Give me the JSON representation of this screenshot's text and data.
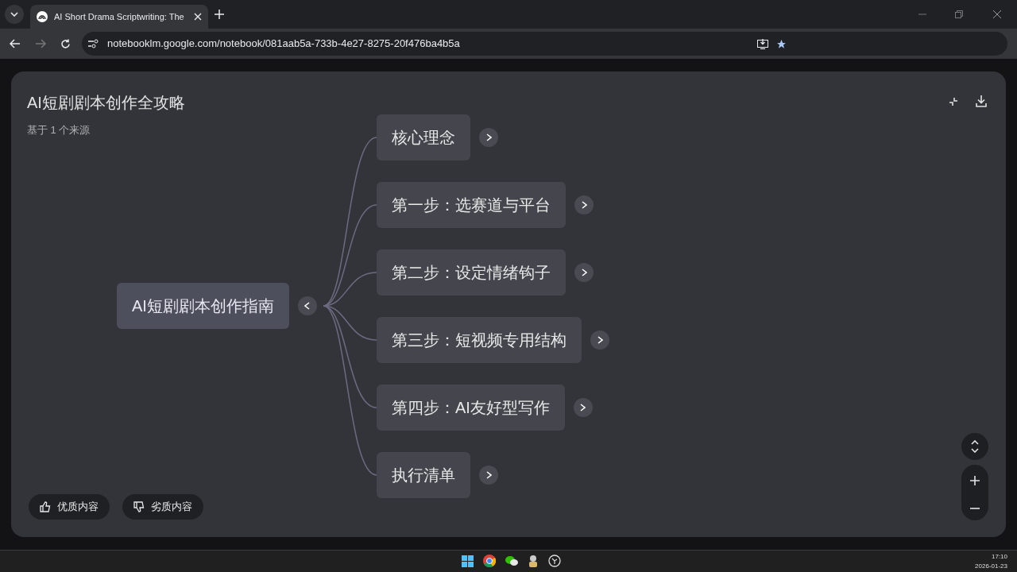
{
  "browser": {
    "tab_title": "AI Short Drama Scriptwriting: The",
    "url": "notebooklm.google.com/notebook/081aab5a-733b-4e27-8275-20f476ba4b5a"
  },
  "mindmap": {
    "title": "AI短剧剧本创作全攻略",
    "subtitle": "基于 1 个来源",
    "root": {
      "label": "AI短剧剧本创作指南",
      "expanded": true,
      "children": [
        {
          "label": "核心理念",
          "expanded": false
        },
        {
          "label": "第一步：选赛道与平台",
          "expanded": false
        },
        {
          "label": "第二步：设定情绪钩子",
          "expanded": false
        },
        {
          "label": "第三步：短视频专用结构",
          "expanded": false
        },
        {
          "label": "第四步：AI友好型写作",
          "expanded": false
        },
        {
          "label": "执行清单",
          "expanded": false
        }
      ]
    },
    "feedback": [
      "优质内容",
      "劣质内容"
    ]
  },
  "taskbar": {
    "time": "17:10",
    "date": "2026-01-23"
  }
}
